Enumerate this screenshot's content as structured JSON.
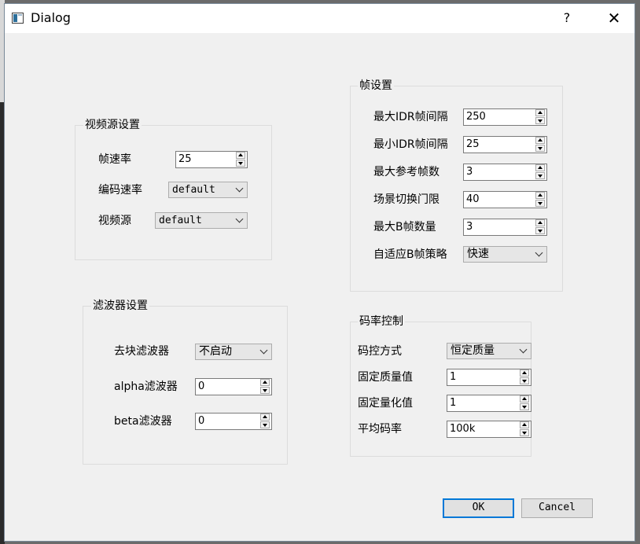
{
  "window": {
    "title": "Dialog",
    "help": "?",
    "close": "✕"
  },
  "video_source": {
    "title": "视频源设置",
    "frame_rate": {
      "label": "帧速率",
      "value": "25"
    },
    "encode_rate": {
      "label": "编码速率",
      "value": "default"
    },
    "source": {
      "label": "视频源",
      "value": "default"
    }
  },
  "filter": {
    "title": "滤波器设置",
    "deblock": {
      "label": "去块滤波器",
      "value": "不启动"
    },
    "alpha": {
      "label": "alpha滤波器",
      "value": "0"
    },
    "beta": {
      "label": "beta滤波器",
      "value": "0"
    }
  },
  "frame": {
    "title": "帧设置",
    "max_idr": {
      "label": "最大IDR帧间隔",
      "value": "250"
    },
    "min_idr": {
      "label": "最小IDR帧间隔",
      "value": "25"
    },
    "max_ref": {
      "label": "最大参考帧数",
      "value": "3"
    },
    "scene_cut": {
      "label": "场景切换门限",
      "value": "40"
    },
    "max_b": {
      "label": "最大B帧数量",
      "value": "3"
    },
    "adaptive_b": {
      "label": "自适应B帧策略",
      "value": "快速"
    }
  },
  "rate_control": {
    "title": "码率控制",
    "mode": {
      "label": "码控方式",
      "value": "恒定质量"
    },
    "quality": {
      "label": "固定质量值",
      "value": "1"
    },
    "quant": {
      "label": "固定量化值",
      "value": "1"
    },
    "bitrate": {
      "label": "平均码率",
      "value": "100k"
    }
  },
  "buttons": {
    "ok": "OK",
    "cancel": "Cancel"
  }
}
